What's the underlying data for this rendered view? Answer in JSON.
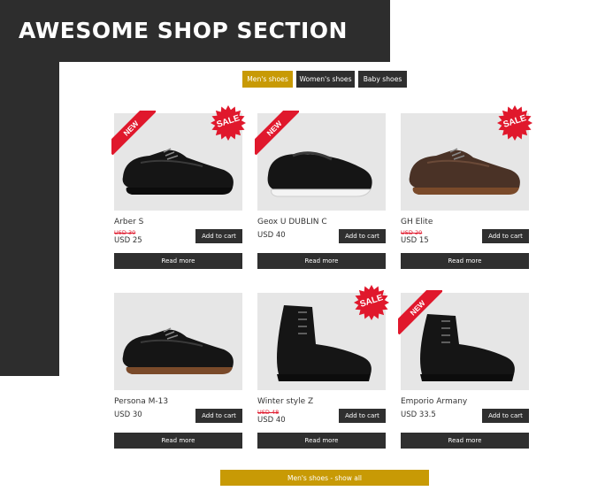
{
  "banner": {
    "title": "AWESOME SHOP SECTION"
  },
  "tabs": [
    {
      "label": "Men's shoes",
      "active": true
    },
    {
      "label": "Women's shoes",
      "active": false
    },
    {
      "label": "Baby shoes",
      "active": false
    }
  ],
  "badges": {
    "new": "NEW",
    "sale": "SALE"
  },
  "products": [
    {
      "name": "Arber S",
      "old_price": "USD 30",
      "price": "USD 25",
      "cart_label": "Add to cart",
      "more_label": "Read more",
      "badge_new": true,
      "badge_sale": true,
      "shoe_color": "black",
      "shoe_icon": "oxford-shoe-icon"
    },
    {
      "name": "Geox U DUBLIN C",
      "old_price": "",
      "price": "USD 40",
      "cart_label": "Add to cart",
      "more_label": "Read more",
      "badge_new": true,
      "badge_sale": false,
      "shoe_color": "black",
      "shoe_icon": "slip-on-shoe-icon"
    },
    {
      "name": "GH Elite",
      "old_price": "USD 20",
      "price": "USD 15",
      "cart_label": "Add to cart",
      "more_label": "Read more",
      "badge_new": false,
      "badge_sale": true,
      "shoe_color": "brown",
      "shoe_icon": "brogue-shoe-icon"
    },
    {
      "name": "Persona M-13",
      "old_price": "",
      "price": "USD 30",
      "cart_label": "Add to cart",
      "more_label": "Read more",
      "badge_new": false,
      "badge_sale": false,
      "shoe_color": "black",
      "shoe_icon": "wingtip-shoe-icon"
    },
    {
      "name": "Winter style Z",
      "old_price": "USD 48",
      "price": "USD 40",
      "cart_label": "Add to cart",
      "more_label": "Read more",
      "badge_new": false,
      "badge_sale": true,
      "shoe_color": "black",
      "shoe_icon": "boot-icon"
    },
    {
      "name": "Emporio Armany",
      "old_price": "",
      "price": "USD 33.5",
      "cart_label": "Add to cart",
      "more_label": "Read more",
      "badge_new": true,
      "badge_sale": false,
      "shoe_color": "black",
      "shoe_icon": "chukka-boot-icon"
    }
  ],
  "show_all_label": "Men's shoes - show all",
  "colors": {
    "accent": "#c89a05",
    "dark": "#2f2f2f",
    "badge_red": "#e0182c",
    "hero_bg": "#2d2d2d"
  }
}
